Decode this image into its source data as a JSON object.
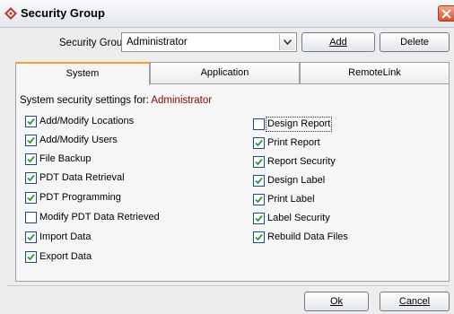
{
  "window": {
    "title": "Security Group",
    "logo_icon": "security-diamond-icon",
    "close_icon": "close-x-icon",
    "close_color": "#d8502b"
  },
  "selector": {
    "label": "Security Group",
    "value": "Administrator",
    "add_label": "Add",
    "delete_label": "Delete"
  },
  "tabs": [
    {
      "label": "System",
      "active": true
    },
    {
      "label": "Application",
      "active": false
    },
    {
      "label": "RemoteLink",
      "active": false
    }
  ],
  "panel": {
    "heading_prefix": "System security settings for:",
    "heading_name": "Administrator",
    "heading_name_color": "#8b0000",
    "left_checkboxes": [
      {
        "label": "Add/Modify Locations",
        "checked": true
      },
      {
        "label": "Add/Modify Users",
        "checked": true
      },
      {
        "label": "File Backup",
        "checked": true
      },
      {
        "label": "PDT Data Retrieval",
        "checked": true
      },
      {
        "label": "PDT Programming",
        "checked": true
      },
      {
        "label": "Modify PDT Data Retrieved",
        "checked": false
      },
      {
        "label": "Import Data",
        "checked": true
      },
      {
        "label": "Export Data",
        "checked": true
      }
    ],
    "right_checkboxes": [
      {
        "label": "Design Report",
        "checked": false
      },
      {
        "label": "Print Report",
        "checked": true
      },
      {
        "label": "Report Security",
        "checked": true
      },
      {
        "label": "Design Label",
        "checked": true
      },
      {
        "label": "Print Label",
        "checked": true
      },
      {
        "label": "Label Security",
        "checked": true
      },
      {
        "label": "Rebuild Data Files",
        "checked": true
      }
    ]
  },
  "footer": {
    "ok_label": "Ok",
    "cancel_label": "Cancel"
  },
  "colors": {
    "accent_tab": "#f3a12a",
    "check_green": "#2f9a2f"
  }
}
